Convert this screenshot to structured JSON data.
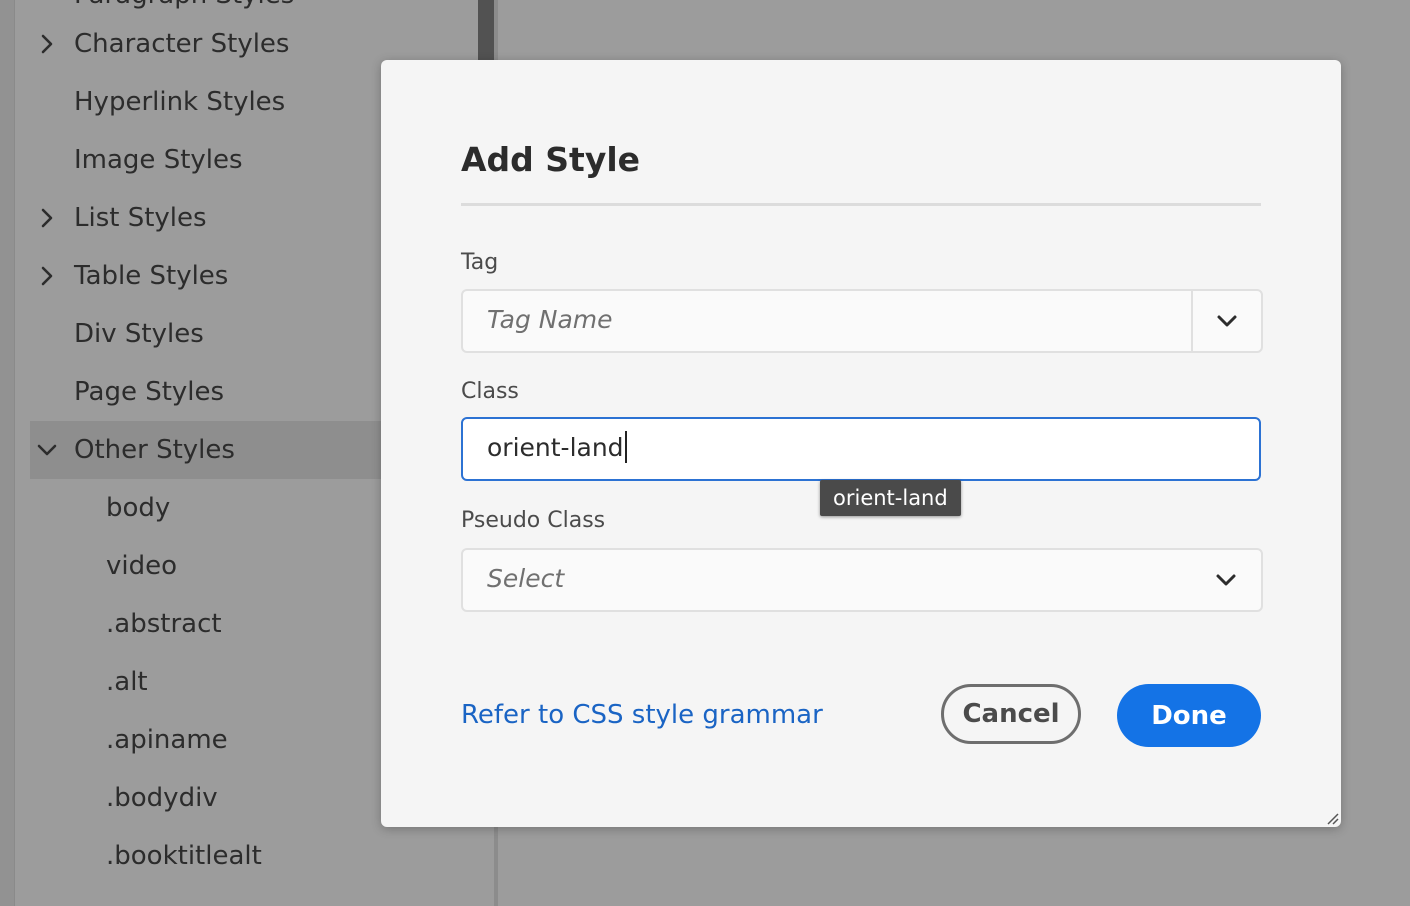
{
  "sidebar": {
    "partial_top_item": "Paragraph Styles",
    "items": [
      {
        "label": "Character Styles",
        "expandable": true,
        "expanded": false
      },
      {
        "label": "Hyperlink Styles",
        "expandable": false
      },
      {
        "label": "Image Styles",
        "expandable": false
      },
      {
        "label": "List Styles",
        "expandable": true,
        "expanded": false
      },
      {
        "label": "Table Styles",
        "expandable": true,
        "expanded": false
      },
      {
        "label": "Div Styles",
        "expandable": false
      },
      {
        "label": "Page Styles",
        "expandable": false
      },
      {
        "label": "Other Styles",
        "expandable": true,
        "expanded": true,
        "selected": true
      }
    ],
    "children": [
      {
        "label": "body"
      },
      {
        "label": "video"
      },
      {
        "label": ".abstract"
      },
      {
        "label": ".alt"
      },
      {
        "label": ".apiname"
      },
      {
        "label": ".bodydiv"
      },
      {
        "label": ".booktitlealt"
      }
    ]
  },
  "dialog": {
    "title": "Add Style",
    "tag": {
      "label": "Tag",
      "placeholder": "Tag Name",
      "icon": "chevron-down-icon"
    },
    "class": {
      "label": "Class",
      "value": "orient-land",
      "tooltip": "orient-land"
    },
    "pseudo_class": {
      "label": "Pseudo Class",
      "placeholder": "Select",
      "icon": "chevron-down-icon"
    },
    "link_label": "Refer to CSS style grammar",
    "cancel_label": "Cancel",
    "done_label": "Done"
  },
  "colors": {
    "accent": "#1473e6",
    "link": "#1a64c4",
    "focus_border": "#2c72d3",
    "backdrop": "#9c9c9c"
  }
}
